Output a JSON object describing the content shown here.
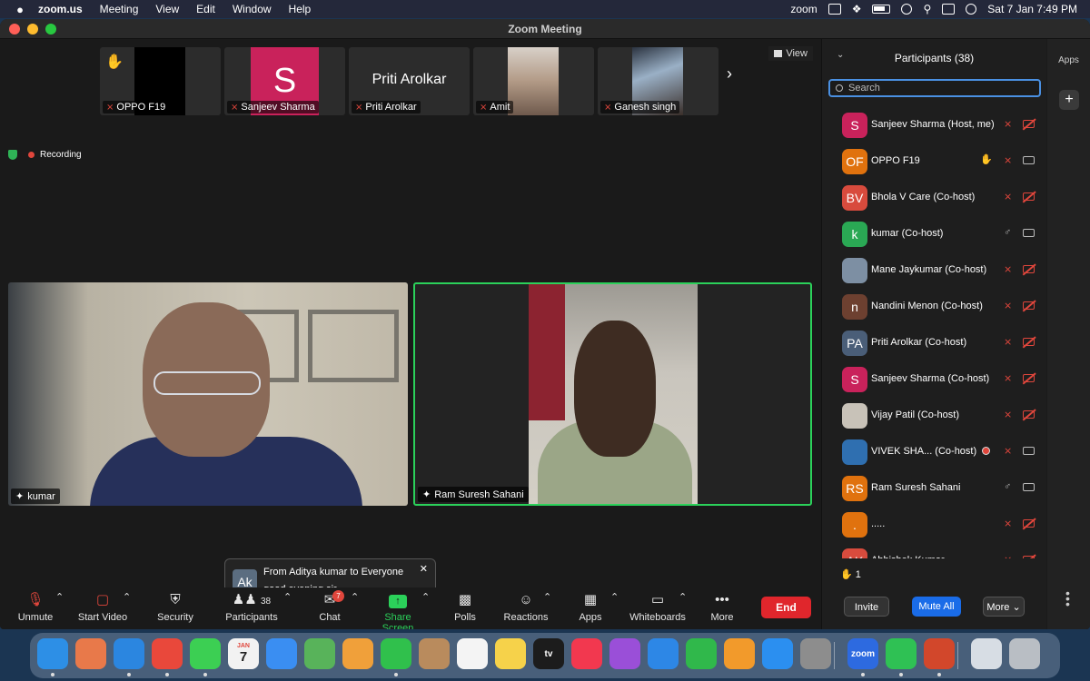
{
  "menubar": {
    "app": "zoom.us",
    "items": [
      "Meeting",
      "View",
      "Edit",
      "Window",
      "Help"
    ],
    "right_app": "zoom",
    "datetime": "Sat 7 Jan  7:49 PM"
  },
  "window": {
    "title": "Zoom Meeting"
  },
  "strip": {
    "thumbs": [
      {
        "name": "OPPO F19"
      },
      {
        "name": "Sanjeev Sharma",
        "initial": "S"
      },
      {
        "name": "Priti Arolkar",
        "big": "Priti Arolkar"
      },
      {
        "name": "Amit"
      },
      {
        "name": "Ganesh singh"
      }
    ],
    "view_label": "View"
  },
  "recording": "Recording",
  "videos": [
    {
      "name": "kumar"
    },
    {
      "name": "Ram Suresh Sahani"
    }
  ],
  "toast": {
    "initials": "Ak",
    "from": "From Aditya kumar to Everyone",
    "message": "good evening sir",
    "close": "✕"
  },
  "toolbar": {
    "unmute": "Unmute",
    "start_video": "Start Video",
    "security": "Security",
    "participants": "Participants",
    "participants_count": "38",
    "chat": "Chat",
    "chat_badge": "7",
    "share_screen": "Share Screen",
    "polls": "Polls",
    "reactions": "Reactions",
    "apps": "Apps",
    "whiteboards": "Whiteboards",
    "more": "More",
    "end": "End"
  },
  "panel": {
    "title": "Participants (38)",
    "search_placeholder": "Search",
    "participants": [
      {
        "initials": "S",
        "name": "Sanjeev Sharma (Host, me)",
        "color": "#c9225b",
        "mic": "off",
        "cam": "off"
      },
      {
        "initials": "OF",
        "name": "OPPO F19",
        "color": "#e0720e",
        "mic": "off",
        "cam": "on",
        "status": "hand"
      },
      {
        "initials": "BV",
        "name": "Bhola V Care (Co-host)",
        "color": "#d84b3d",
        "mic": "off",
        "cam": "off"
      },
      {
        "initials": "k",
        "name": "kumar (Co-host)",
        "color": "#2aa854",
        "mic": "on",
        "cam": "on"
      },
      {
        "initials": "",
        "name": "Mane Jaykumar (Co-host)",
        "color": "#7d8fa3",
        "mic": "off",
        "cam": "off"
      },
      {
        "initials": "n",
        "name": "Nandini Menon (Co-host)",
        "color": "#6d4030",
        "mic": "off",
        "cam": "off"
      },
      {
        "initials": "PA",
        "name": "Priti Arolkar (Co-host)",
        "color": "#4a5e78",
        "mic": "off",
        "cam": "off"
      },
      {
        "initials": "S",
        "name": "Sanjeev Sharma (Co-host)",
        "color": "#c9225b",
        "mic": "off",
        "cam": "off"
      },
      {
        "initials": "",
        "name": "Vijay Patil (Co-host)",
        "color": "#c8c2b8",
        "mic": "off",
        "cam": "off"
      },
      {
        "initials": "",
        "name": "VIVEK SHA... (Co-host)",
        "color": "#2f6fb0",
        "mic": "off",
        "cam": "on",
        "status": "rec"
      },
      {
        "initials": "RS",
        "name": "Ram Suresh Sahani",
        "color": "#e0720e",
        "mic": "on",
        "cam": "on"
      },
      {
        "initials": ".",
        "name": ".....",
        "color": "#e0720e",
        "mic": "off",
        "cam": "off"
      },
      {
        "initials": "AK",
        "name": "Abhishek Kumar",
        "color": "#d84b3d",
        "mic": "off",
        "cam": "off"
      }
    ],
    "raised_hands": "1",
    "invite": "Invite",
    "mute_all": "Mute All",
    "more": "More"
  },
  "rail": {
    "apps": "Apps"
  },
  "dock": {
    "icons": [
      {
        "name": "finder",
        "color": "#2d8fe6"
      },
      {
        "name": "launchpad",
        "color": "#e8794a"
      },
      {
        "name": "safari",
        "color": "#2b86e0"
      },
      {
        "name": "chrome",
        "color": "#e9483b"
      },
      {
        "name": "messages",
        "color": "#3ccf53"
      },
      {
        "name": "calendar",
        "color": "#f2f2f2"
      },
      {
        "name": "mail",
        "color": "#3a8ef2"
      },
      {
        "name": "maps",
        "color": "#58b35a"
      },
      {
        "name": "photos",
        "color": "#f0a03a"
      },
      {
        "name": "facetime",
        "color": "#30c04c"
      },
      {
        "name": "contacts",
        "color": "#b98b5d"
      },
      {
        "name": "reminders",
        "color": "#f4f4f4"
      },
      {
        "name": "notes",
        "color": "#f6d24a"
      },
      {
        "name": "apple-tv",
        "color": "#1c1c1c"
      },
      {
        "name": "music",
        "color": "#f2384f"
      },
      {
        "name": "podcasts",
        "color": "#9a4fd8"
      },
      {
        "name": "keynote",
        "color": "#2d87e6"
      },
      {
        "name": "numbers",
        "color": "#30b84b"
      },
      {
        "name": "pages",
        "color": "#f29a2b"
      },
      {
        "name": "app-store",
        "color": "#2b8ff0"
      },
      {
        "name": "system-settings",
        "color": "#8d8d8d"
      },
      {
        "name": "zoom",
        "color": "#2d6ae0"
      },
      {
        "name": "whatsapp",
        "color": "#2fc154"
      },
      {
        "name": "powerpoint",
        "color": "#d2472b"
      },
      {
        "name": "window-preview",
        "color": "#d7dde4"
      },
      {
        "name": "trash",
        "color": "#b9bec4"
      }
    ],
    "calendar_month": "JAN",
    "calendar_day": "7",
    "appletv_label": "tv",
    "zoom_label": "zoom"
  }
}
